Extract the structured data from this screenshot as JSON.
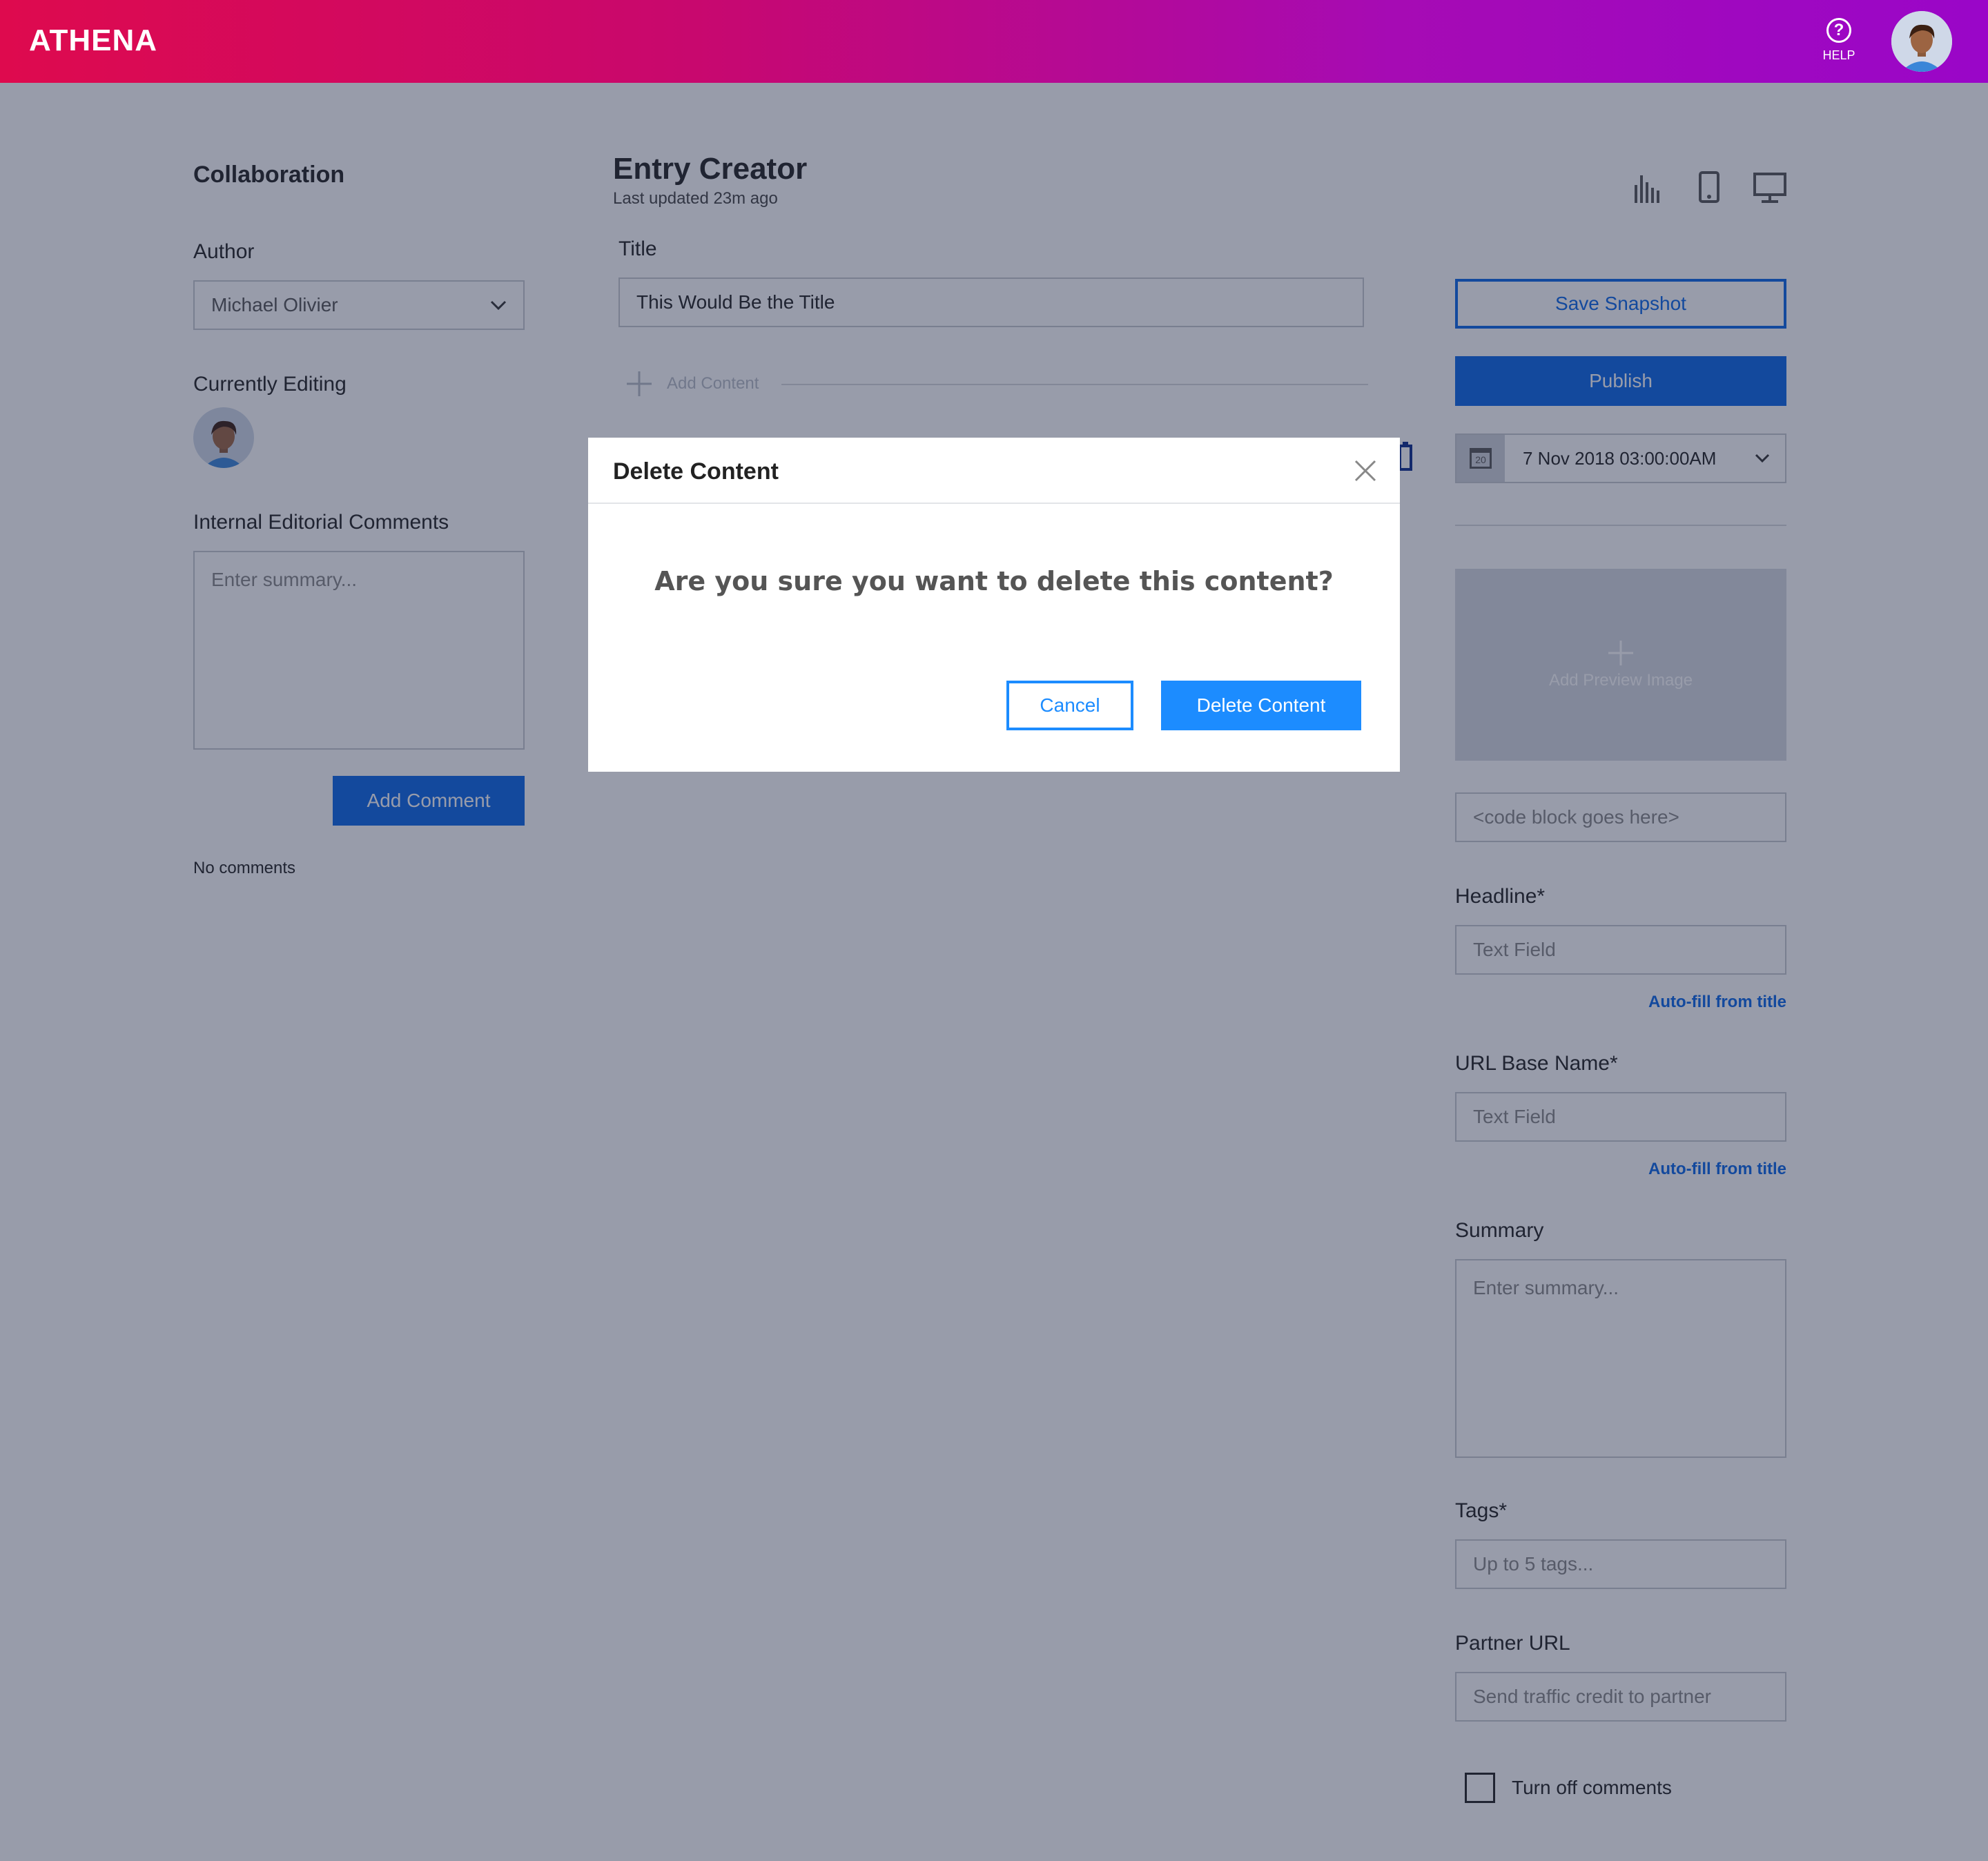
{
  "header": {
    "logo": "ATHENA",
    "help_label": "HELP",
    "help_glyph": "?"
  },
  "sidebar": {
    "title": "Collaboration",
    "author_label": "Author",
    "author_value": "Michael Olivier",
    "currently_editing_label": "Currently Editing",
    "comments_label": "Internal Editorial Comments",
    "comments_placeholder": "Enter summary...",
    "add_comment": "Add Comment",
    "no_comments": "No comments"
  },
  "main": {
    "title": "Entry Creator",
    "last_updated": "Last updated 23m ago",
    "title_label": "Title",
    "title_value": "This Would Be the Title",
    "add_content": "Add Content"
  },
  "right": {
    "save_snapshot": "Save Snapshot",
    "publish": "Publish",
    "date_value": "7 Nov 2018 03:00:00AM",
    "calendar_day": "20",
    "add_preview_image": "Add Preview Image",
    "code_placeholder": "<code block goes here>",
    "headline_label": "Headline*",
    "headline_placeholder": "Text Field",
    "autofill_1": "Auto-fill from title",
    "url_label": "URL Base Name*",
    "url_placeholder": "Text Field",
    "autofill_2": "Auto-fill from title",
    "summary_label": "Summary",
    "summary_placeholder": "Enter summary...",
    "tags_label": "Tags*",
    "tags_placeholder": "Up to 5 tags...",
    "partner_label": "Partner URL",
    "partner_placeholder": "Send traffic credit to partner",
    "turn_off_comments": "Turn off comments"
  },
  "modal": {
    "title": "Delete Content",
    "question": "Are you sure you want to delete this content?",
    "cancel": "Cancel",
    "confirm": "Delete Content"
  },
  "colors": {
    "primary": "#0a66e8",
    "modal_accent": "#1c8cff",
    "header_start": "#de0a4e",
    "header_end": "#9a06c8"
  },
  "icons": [
    "help-icon",
    "user-avatar",
    "analytics-icon",
    "mobile-preview-icon",
    "desktop-preview-icon",
    "calendar-icon",
    "chevron-down-icon",
    "plus-icon",
    "trash-icon",
    "close-icon"
  ]
}
